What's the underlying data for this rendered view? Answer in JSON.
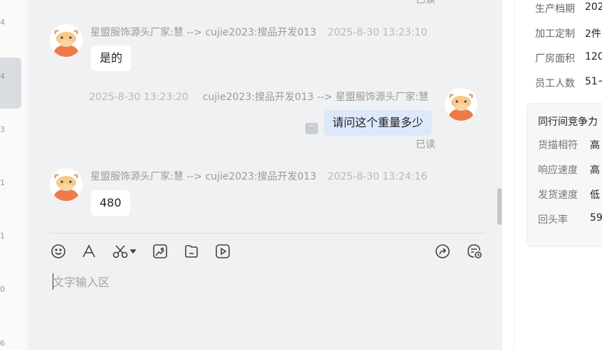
{
  "left_strip": {
    "numbers": [
      "4",
      "4",
      "3",
      "1",
      "1",
      "0",
      "6"
    ]
  },
  "chat": {
    "top_read_label": "已读",
    "messages": [
      {
        "direction": "in",
        "sender": "星盟服饰源头厂家:慧 --> cujie2023:搜品开发013",
        "time": "2025-8-30 13:23:10",
        "text": "是的"
      },
      {
        "direction": "out",
        "sender": "cujie2023:搜品开发013 --> 星盟服饰源头厂家:慧",
        "time": "2025-8-30 13:23:20",
        "text": "请问这个重量多少",
        "status": "已读"
      },
      {
        "direction": "in",
        "sender": "星盟服饰源头厂家:慧 --> cujie2023:搜品开发013",
        "time": "2025-8-30 13:24:16",
        "text": "480"
      }
    ],
    "toolbar": [
      "emoji-icon",
      "font-icon",
      "scissors-icon",
      "image-icon",
      "file-icon",
      "video-icon",
      "share-icon",
      "chat-history-icon"
    ],
    "input_placeholder": "文字输入区"
  },
  "right_panel": {
    "info": [
      {
        "label": "生产档期",
        "value": "202"
      },
      {
        "label": "加工定制",
        "value": "2件"
      },
      {
        "label": "厂房面积",
        "value": "120"
      },
      {
        "label": "员工人数",
        "value": "51~"
      }
    ],
    "compete": {
      "title": "同行间竞争力",
      "rows": [
        {
          "label": "货描相符",
          "value": "高"
        },
        {
          "label": "响应速度",
          "value": "高"
        },
        {
          "label": "发货速度",
          "value": "低"
        },
        {
          "label": "回头率",
          "value": "59"
        }
      ]
    }
  },
  "colors": {
    "chat_bg": "#f0f1f3",
    "out_bubble": "#dde9fb",
    "avatar_orange": "#f07a47"
  }
}
